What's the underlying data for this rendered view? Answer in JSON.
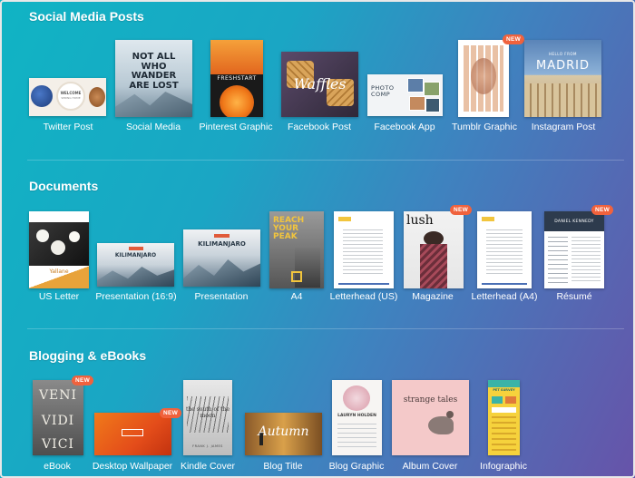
{
  "sections": {
    "social": {
      "title": "Social Media Posts",
      "items": [
        {
          "caption": "Twitter Post",
          "text": "WELCOME",
          "text2": "SPRING HOME"
        },
        {
          "caption": "Social Media",
          "text": "NOT ALL WHO WANDER ARE LOST"
        },
        {
          "caption": "Pinterest Graphic",
          "text": "FRESHSTART"
        },
        {
          "caption": "Facebook Post",
          "text": "Waffles"
        },
        {
          "caption": "Facebook App",
          "text": "PHOTO COMP"
        },
        {
          "caption": "Tumblr Graphic",
          "badge": "NEW"
        },
        {
          "caption": "Instagram Post",
          "text": "HELLO FROM",
          "text2": "MADRID"
        }
      ]
    },
    "documents": {
      "title": "Documents",
      "items": [
        {
          "caption": "US Letter",
          "text": "Yallane"
        },
        {
          "caption": "Presentation (16:9)",
          "text": "KILIMANJARO"
        },
        {
          "caption": "Presentation",
          "text": "KILIMANJARO"
        },
        {
          "caption": "A4",
          "text": "REACH YOUR PEAK"
        },
        {
          "caption": "Letterhead (US)"
        },
        {
          "caption": "Magazine",
          "text": "lush",
          "badge": "NEW"
        },
        {
          "caption": "Letterhead (A4)"
        },
        {
          "caption": "Résumé",
          "text": "DANIEL KENNEDY",
          "badge": "NEW"
        }
      ]
    },
    "blogging": {
      "title": "Blogging & eBooks",
      "items": [
        {
          "caption": "eBook",
          "text": "VENI",
          "text2": "VIDI",
          "text3": "VICI",
          "badge": "NEW"
        },
        {
          "caption": "Desktop Wallpaper",
          "badge": "NEW"
        },
        {
          "caption": "Kindle Cover",
          "text": "the south of the moon",
          "text2": "FRANK J. JAMES"
        },
        {
          "caption": "Blog Title",
          "text": "Autumn"
        },
        {
          "caption": "Blog Graphic",
          "text": "LAURYN HOLDEN"
        },
        {
          "caption": "Album Cover",
          "text": "strange tales"
        },
        {
          "caption": "Infographic",
          "text": "PET SURVEY"
        }
      ]
    }
  }
}
